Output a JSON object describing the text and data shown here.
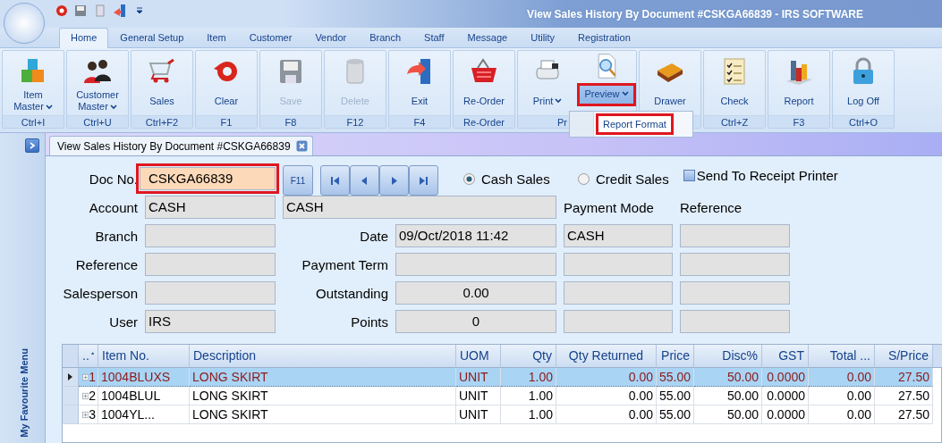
{
  "window": {
    "title": "View Sales History By Document #CSKGA66839 - IRS SOFTWARE"
  },
  "ribbon_tabs": [
    {
      "label": "Home",
      "selected": true
    },
    {
      "label": "General Setup",
      "selected": false
    },
    {
      "label": "Item",
      "selected": false
    },
    {
      "label": "Customer",
      "selected": false
    },
    {
      "label": "Vendor",
      "selected": false
    },
    {
      "label": "Branch",
      "selected": false
    },
    {
      "label": "Staff",
      "selected": false
    },
    {
      "label": "Message",
      "selected": false
    },
    {
      "label": "Utility",
      "selected": false
    },
    {
      "label": "Registration",
      "selected": false
    }
  ],
  "ribbon_groups": [
    {
      "footer": "Ctrl+I",
      "buttons": [
        {
          "label": "Item Master",
          "kind": "cubes",
          "dropdown": true,
          "disabled": false,
          "highlighted": false
        }
      ]
    },
    {
      "footer": "Ctrl+U",
      "buttons": [
        {
          "label": "Customer Master",
          "kind": "people",
          "dropdown": true,
          "disabled": false,
          "highlighted": false
        }
      ]
    },
    {
      "footer": "Ctrl+F2",
      "buttons": [
        {
          "label": "Sales",
          "kind": "cart",
          "dropdown": false,
          "disabled": false,
          "highlighted": false
        }
      ]
    },
    {
      "footer": "F1",
      "buttons": [
        {
          "label": "Clear",
          "kind": "clear",
          "dropdown": false,
          "disabled": false,
          "highlighted": false
        }
      ]
    },
    {
      "footer": "F8",
      "buttons": [
        {
          "label": "Save",
          "kind": "save",
          "dropdown": false,
          "disabled": true,
          "highlighted": false
        }
      ]
    },
    {
      "footer": "F12",
      "buttons": [
        {
          "label": "Delete",
          "kind": "trash",
          "dropdown": false,
          "disabled": true,
          "highlighted": false
        }
      ]
    },
    {
      "footer": "F4",
      "buttons": [
        {
          "label": "Exit",
          "kind": "exit",
          "dropdown": false,
          "disabled": false,
          "highlighted": false
        }
      ]
    },
    {
      "footer": "Re-Order",
      "buttons": [
        {
          "label": "Re-Order",
          "kind": "basket",
          "dropdown": false,
          "disabled": false,
          "highlighted": false
        }
      ]
    },
    {
      "footer": "Pr",
      "buttons": [
        {
          "label": "Print",
          "kind": "printer",
          "dropdown": true,
          "disabled": false,
          "highlighted": false
        },
        {
          "label": "Preview",
          "kind": "preview",
          "dropdown": true,
          "disabled": false,
          "highlighted": true
        }
      ]
    },
    {
      "buttons": [
        {
          "label": "Drawer",
          "kind": "book",
          "dropdown": false,
          "disabled": false,
          "highlighted": false
        }
      ]
    },
    {
      "footer": "Ctrl+Z",
      "buttons": [
        {
          "label": "Check",
          "kind": "checklist",
          "dropdown": false,
          "disabled": false,
          "highlighted": false
        }
      ]
    },
    {
      "footer": "F3",
      "buttons": [
        {
          "label": "Report",
          "kind": "chart",
          "dropdown": false,
          "disabled": false,
          "highlighted": false
        }
      ]
    },
    {
      "footer": "Ctrl+O",
      "buttons": [
        {
          "label": "Log Off",
          "kind": "lock",
          "dropdown": false,
          "disabled": false,
          "highlighted": false
        }
      ]
    }
  ],
  "dropdown_menu": {
    "items": [
      {
        "label": "Report Format",
        "highlighted": true
      }
    ]
  },
  "sidebar": {
    "title": "My Favourite Menu"
  },
  "document_tab": {
    "title": "View Sales History By Document #CSKGA66839"
  },
  "form": {
    "doc_no": {
      "label": "Doc No.",
      "value": "CSKGA66839",
      "highlighted": true
    },
    "lookup_button": "F11",
    "sale_types": [
      {
        "label": "Cash Sales",
        "selected": true
      },
      {
        "label": "Credit Sales",
        "selected": false
      }
    ],
    "send_to_receipt_printer": {
      "label": "Send To Receipt Printer",
      "checked": false
    },
    "account": {
      "label": "Account",
      "code": "CASH",
      "name": "CASH"
    },
    "payment_mode_label": "Payment Mode",
    "reference_label": "Reference",
    "rows": [
      {
        "label": "Branch",
        "label_2": "Date",
        "value_2": "09/Oct/2018 11:42",
        "payment_mode": "CASH"
      },
      {
        "label": "Reference",
        "label_2": "Payment Term"
      },
      {
        "label": "Salesperson",
        "label_2": "Outstanding",
        "value_2": "0.00"
      },
      {
        "label": "User",
        "value": "IRS",
        "label_2": "Points",
        "value_2": "0"
      }
    ]
  },
  "table": {
    "columns": [
      {
        "label": "..",
        "kind": "rownum",
        "sorted_ascending": true
      },
      {
        "label": "Item No.",
        "kind": "text"
      },
      {
        "label": "Description",
        "kind": "text"
      },
      {
        "label": "UOM",
        "kind": "text"
      },
      {
        "label": "Qty",
        "kind": "number"
      },
      {
        "label": "Qty Returned",
        "kind": "number"
      },
      {
        "label": "Price",
        "kind": "number"
      },
      {
        "label": "Disc%",
        "kind": "number"
      },
      {
        "label": "GST",
        "kind": "number"
      },
      {
        "label": "Total ...",
        "kind": "number"
      },
      {
        "label": "S/Price",
        "kind": "number"
      }
    ],
    "rows": [
      {
        "selected": true,
        "cells": [
          "1",
          "1004BLUXS",
          "LONG SKIRT",
          "UNIT",
          "1.00",
          "0.00",
          "55.00",
          "50.00",
          "0.0000",
          "0.00",
          "27.50"
        ]
      },
      {
        "selected": false,
        "cells": [
          "2",
          "1004BLUL",
          "LONG SKIRT",
          "UNIT",
          "1.00",
          "0.00",
          "55.00",
          "50.00",
          "0.0000",
          "0.00",
          "27.50"
        ]
      },
      {
        "selected": false,
        "cells": [
          "3",
          "1004YL...",
          "LONG SKIRT",
          "UNIT",
          "1.00",
          "0.00",
          "55.00",
          "50.00",
          "0.0000",
          "0.00",
          "27.50"
        ]
      }
    ]
  }
}
